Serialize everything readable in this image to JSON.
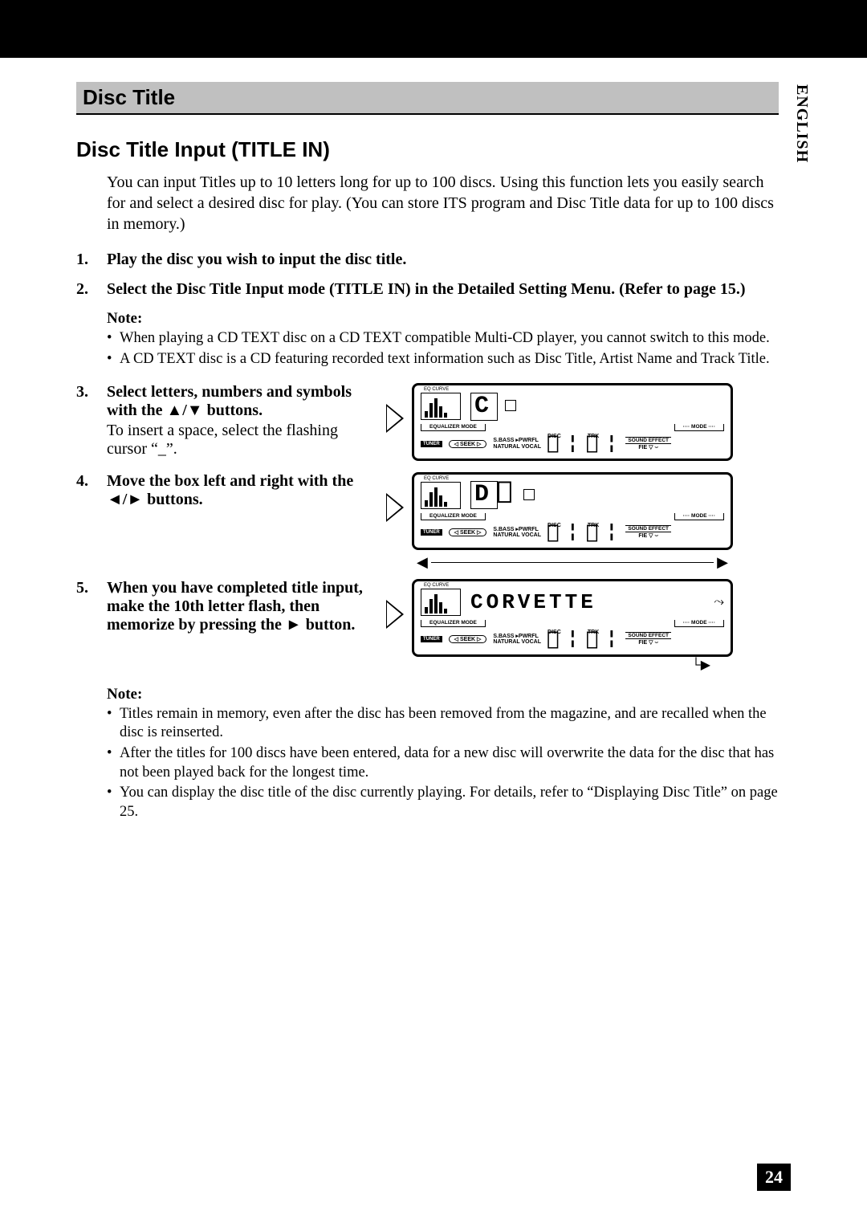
{
  "side_tab": "ENGLISH",
  "page_number": "24",
  "section_title": "Disc Title",
  "subsection_title": "Disc Title Input (TITLE IN)",
  "intro": "You can input Titles up to 10 letters long for up to 100 discs. Using this function lets you easily search for and select a desired disc for play. (You can store ITS program and Disc Title data for up to 100 discs in memory.)",
  "steps": {
    "s1": {
      "num": "1.",
      "title": "Play the disc you wish to input the disc title."
    },
    "s2": {
      "num": "2.",
      "title": "Select the Disc Title Input mode (TITLE IN) in the Detailed Setting Menu. (Refer to page 15.)"
    },
    "s3": {
      "num": "3.",
      "title": "Select letters, numbers and symbols with the ▲/▼ buttons.",
      "desc": "To insert a space, select the flashing cursor “_”."
    },
    "s4": {
      "num": "4.",
      "title": "Move the box left and right with the ◄/► buttons."
    },
    "s5": {
      "num": "5.",
      "title": "When you have completed title input, make the 10th letter flash, then memorize by pressing the ► button."
    }
  },
  "note1": {
    "label": "Note:",
    "items": [
      "When playing a CD TEXT disc on a CD TEXT compatible Multi-CD player, you cannot switch to this mode.",
      "A CD TEXT disc is a CD featuring recorded text information such as Disc Title, Artist Name and Track Title."
    ]
  },
  "note2": {
    "label": "Note:",
    "items": [
      "Titles remain in memory, even after the disc has been removed from the magazine, and are recalled when the disc is reinserted.",
      "After the titles for 100 discs have been entered, data for a new disc will overwrite the data for the disc that has not been played back for the longest time.",
      "You can display the disc title of the disc currently playing. For details, refer to “Displaying Disc Title” on page 25."
    ]
  },
  "display": {
    "eq_label": "EQ CURVE",
    "equalizer_mode": "EQUALIZER MODE",
    "mode": "···· MODE ····",
    "tuner": "TUNER",
    "seek": "◁ SEEK ▷",
    "sbass": "S.BASS ▸PWRFL",
    "natural": "NATURAL  VOCAL",
    "disc": "DISC",
    "trk": "TRK",
    "sound_effect": "SOUND EFFECT",
    "fie": "FIE  ▽ ⌣",
    "fig3_chars": "C",
    "fig4_chars_pre": "",
    "fig4_box": "D",
    "fig5_title": "CORVETTE"
  }
}
